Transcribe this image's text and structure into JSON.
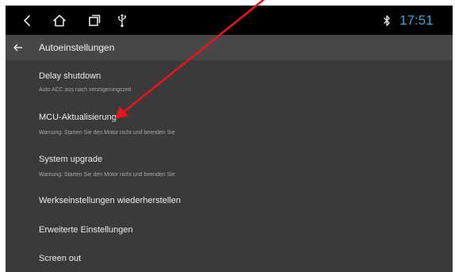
{
  "statusbar": {
    "time": "17:51",
    "icons": [
      "back-icon",
      "home-icon",
      "recents-icon",
      "usb-icon",
      "bluetooth-icon"
    ],
    "time_color": "#2fa6e6"
  },
  "header": {
    "title": "Autoeinstellungen",
    "back_icon": "arrow-left-icon"
  },
  "settings": {
    "items": [
      {
        "title": "Delay shutdown",
        "subtitle": "Auto ACC aus nach verzögerungszeit"
      },
      {
        "title": "MCU-Aktualisierung",
        "subtitle": "Warnung: Starten Sie den Motor nicht und beenden Sie"
      },
      {
        "title": "System upgrade",
        "subtitle": "Warnung: Starten Sie den Motor nicht und beenden Sie"
      },
      {
        "title": "Werkseinstellungen wiederherstellen"
      },
      {
        "title": "Erweiterte Einstellungen"
      },
      {
        "title": "Screen out"
      }
    ]
  },
  "annotation": {
    "type": "arrow",
    "color": "#e8141b"
  }
}
